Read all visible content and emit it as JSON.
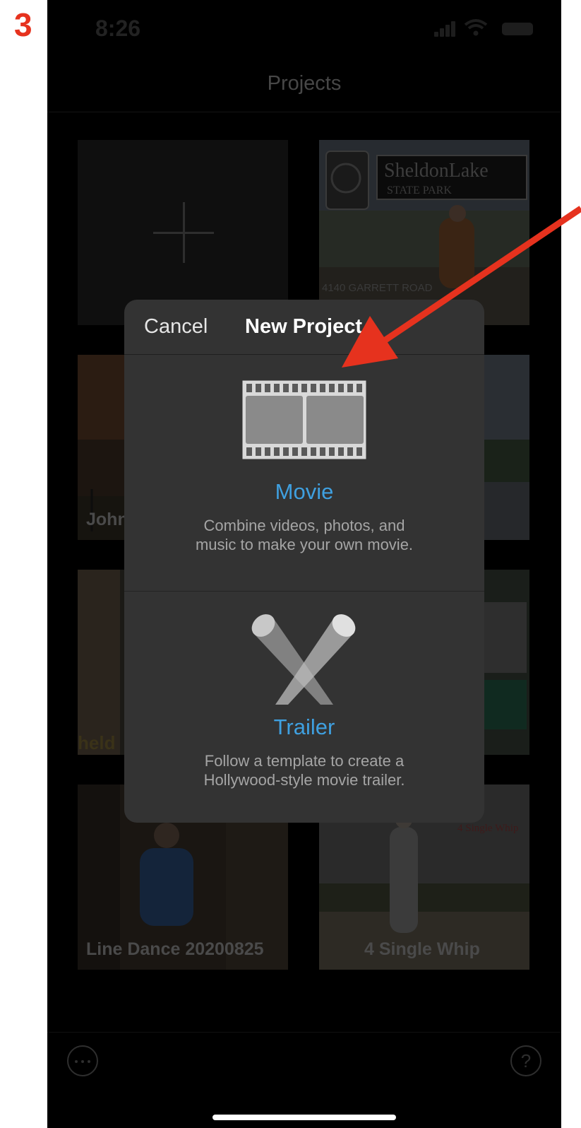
{
  "step_number": "3",
  "status_bar": {
    "time": "8:26"
  },
  "nav": {
    "title": "Projects"
  },
  "projects": [
    {
      "title": ""
    },
    {
      "title": "John"
    },
    {
      "title": ""
    },
    {
      "title": ""
    },
    {
      "title": ""
    },
    {
      "title": "Line Dance 20200825"
    },
    {
      "title": "4 Single Whip"
    }
  ],
  "modal": {
    "cancel_label": "Cancel",
    "title": "New Project",
    "movie": {
      "title": "Movie",
      "desc_line1": "Combine videos, photos, and",
      "desc_line2": "music to make your own movie."
    },
    "trailer": {
      "title": "Trailer",
      "desc_line1": "Follow a template to create a",
      "desc_line2": "Hollywood-style movie trailer."
    }
  },
  "colors": {
    "accent": "#3fa0e0",
    "annotation_arrow": "#e6321e",
    "step_number": "#e6321e"
  },
  "icons": [
    "plus-icon",
    "film-strip-icon",
    "spotlight-icon",
    "more-icon",
    "help-icon"
  ]
}
